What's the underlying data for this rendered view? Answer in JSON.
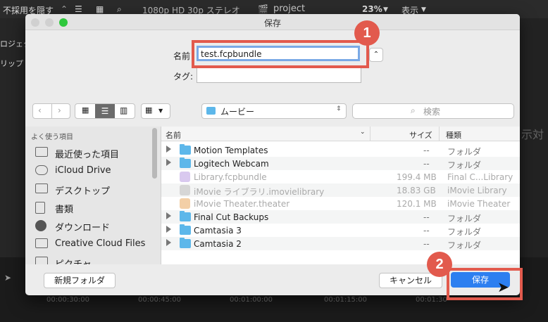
{
  "app": {
    "topbar": {
      "hide_rejected": "不採用を隠す",
      "format": "1080p HD 30p ステレオ",
      "project": "project",
      "zoom": "23%",
      "view": "表示"
    },
    "left_cut_labels": [
      "ロジェク",
      "リップ"
    ],
    "right_cut_label": "示対",
    "timecodes": [
      "00:00:30:00",
      "00:00:45:00",
      "00:01:00:00",
      "00:01:15:00",
      "00:01:30"
    ]
  },
  "dialog": {
    "title": "保存",
    "name_label": "名前",
    "name_value": "test.fcpbundle",
    "tag_label": "タグ:",
    "tag_value": "",
    "location": "ムービー",
    "search_placeholder": "検索",
    "sidebar": {
      "section": "よく使う項目",
      "items": [
        {
          "label": "最近使った項目",
          "icon": "recents-icon"
        },
        {
          "label": "iCloud Drive",
          "icon": "cloud-icon"
        },
        {
          "label": "デスクトップ",
          "icon": "desktop-icon"
        },
        {
          "label": "書類",
          "icon": "documents-icon"
        },
        {
          "label": "ダウンロード",
          "icon": "download-icon"
        },
        {
          "label": "Creative Cloud Files",
          "icon": "folder-icon"
        },
        {
          "label": "ピクチャ",
          "icon": "camera-icon"
        }
      ]
    },
    "columns": {
      "name": "名前",
      "size": "サイズ",
      "kind": "種類"
    },
    "files": [
      {
        "name": "Motion Templates",
        "size": "--",
        "kind": "フォルダ",
        "type": "folder",
        "enabled": true
      },
      {
        "name": "Logitech Webcam",
        "size": "--",
        "kind": "フォルダ",
        "type": "folder",
        "enabled": true
      },
      {
        "name": "Library.fcpbundle",
        "size": "199.4 MB",
        "kind": "Final C...Library",
        "type": "fcp-library",
        "enabled": false
      },
      {
        "name": "iMovie ライブラリ.imovielibrary",
        "size": "18.83 GB",
        "kind": "iMovie Library",
        "type": "imovie-library",
        "enabled": false
      },
      {
        "name": "iMovie Theater.theater",
        "size": "120.1 MB",
        "kind": "iMovie Theater",
        "type": "theater",
        "enabled": false
      },
      {
        "name": "Final Cut Backups",
        "size": "--",
        "kind": "フォルダ",
        "type": "folder",
        "enabled": true
      },
      {
        "name": "Camtasia 3",
        "size": "--",
        "kind": "フォルダ",
        "type": "folder",
        "enabled": true
      },
      {
        "name": "Camtasia 2",
        "size": "--",
        "kind": "フォルダ",
        "type": "folder",
        "enabled": true
      }
    ],
    "buttons": {
      "new_folder": "新規フォルダ",
      "cancel": "キャンセル",
      "save": "保存"
    }
  },
  "annotations": {
    "step1": "1",
    "step2": "2"
  },
  "colors": {
    "accent": "#2d7ff0",
    "annotation": "#e25a4d",
    "folder": "#5db7ea"
  }
}
